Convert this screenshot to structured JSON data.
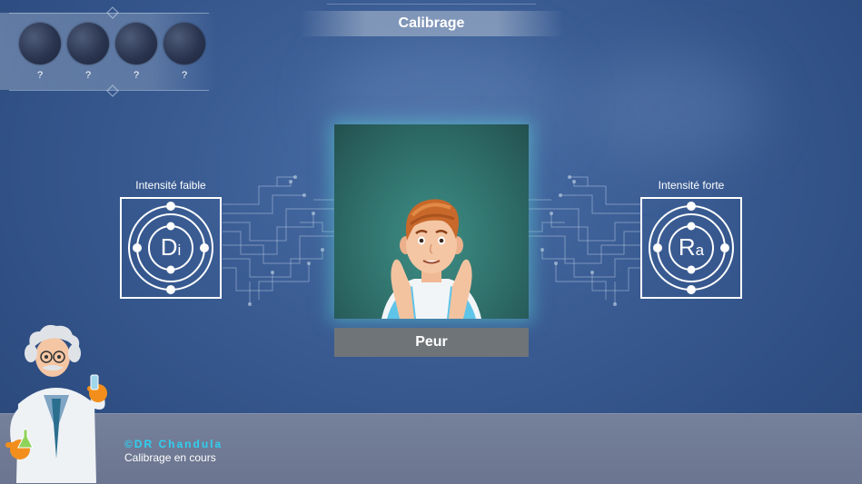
{
  "title": "Calibrage",
  "slots": [
    {
      "label": "?"
    },
    {
      "label": "?"
    },
    {
      "label": "?"
    },
    {
      "label": "?"
    }
  ],
  "left_badge": {
    "label": "Intensité faible",
    "symbol_main": "D",
    "symbol_sub": "i"
  },
  "right_badge": {
    "label": "Intensité forte",
    "symbol_main": "R",
    "symbol_sub": "a"
  },
  "emotion": "Peur",
  "credit": "©DR Chandula",
  "status": "Calibrage en cours",
  "colors": {
    "accent": "#2fd0f0",
    "background": "#3a5c93",
    "emotion_bar": "#6f7478"
  }
}
